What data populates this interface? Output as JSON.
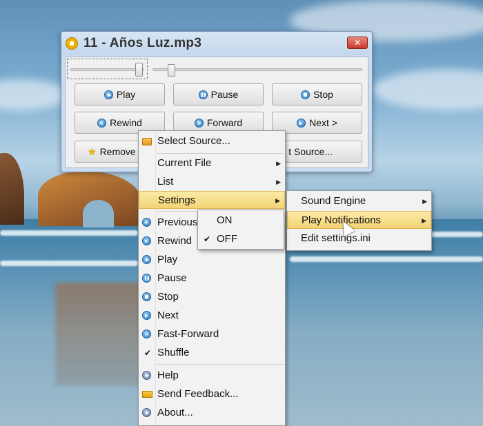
{
  "window": {
    "title": "11 - Años Luz.mp3",
    "close_label": "✕",
    "buttons": {
      "play": "Play",
      "pause": "Pause",
      "stop": "Stop",
      "rewind": "Rewind",
      "forward": "Forward",
      "next": "Next >",
      "remove": "Remove f",
      "source": "t Source..."
    },
    "volume_level": 0.92,
    "seek_position": 0.09
  },
  "main_menu": {
    "items": [
      {
        "label": "Select Source...",
        "icon": "folder-icon"
      },
      {
        "label": "Current File",
        "submenu": true
      },
      {
        "label": "List",
        "submenu": true
      },
      {
        "label": "Settings",
        "submenu": true,
        "highlighted": true
      },
      {
        "label": "Previous",
        "icon": "previous-icon"
      },
      {
        "label": "Rewind",
        "icon": "rewind-icon"
      },
      {
        "label": "Play",
        "icon": "play-icon"
      },
      {
        "label": "Pause",
        "icon": "pause-icon"
      },
      {
        "label": "Stop",
        "icon": "stop-icon"
      },
      {
        "label": "Next",
        "icon": "next-icon"
      },
      {
        "label": "Fast-Forward",
        "icon": "fast-forward-icon"
      },
      {
        "label": "Shuffle",
        "checked": true
      },
      {
        "label": "Help",
        "icon": "help-icon"
      },
      {
        "label": "Send Feedback...",
        "icon": "mail-icon"
      },
      {
        "label": "About...",
        "icon": "info-icon"
      }
    ]
  },
  "settings_menu": {
    "items": [
      {
        "label": "Sound Engine",
        "submenu": true
      },
      {
        "label": "Play Notifications",
        "submenu": true,
        "highlighted": true
      },
      {
        "label": "Edit settings.ini"
      }
    ]
  },
  "notifications_menu": {
    "items": [
      {
        "label": "ON",
        "checked": false
      },
      {
        "label": "OFF",
        "checked": true
      }
    ]
  },
  "colors": {
    "highlight": "#f3d475",
    "menu_bg": "#f2f2f2",
    "icon_blue": "#2a78c2"
  }
}
